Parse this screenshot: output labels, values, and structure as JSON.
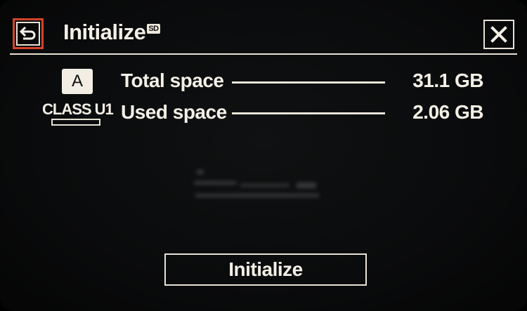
{
  "header": {
    "title": "Initialize",
    "media_badge": "SD",
    "back_icon": "return-arrow-icon",
    "close_icon": "close-x-icon"
  },
  "card": {
    "speed_class_letter": "A",
    "class_label": "CLASS U1"
  },
  "info": [
    {
      "label": "Total space",
      "value": "31.1 GB"
    },
    {
      "label": "Used space",
      "value": "2.06 GB"
    }
  ],
  "actions": {
    "initialize_label": "Initialize"
  },
  "colors": {
    "background": "#0a0b0c",
    "text": "#f4f0e6",
    "accent_back_border": "#d5432a"
  }
}
